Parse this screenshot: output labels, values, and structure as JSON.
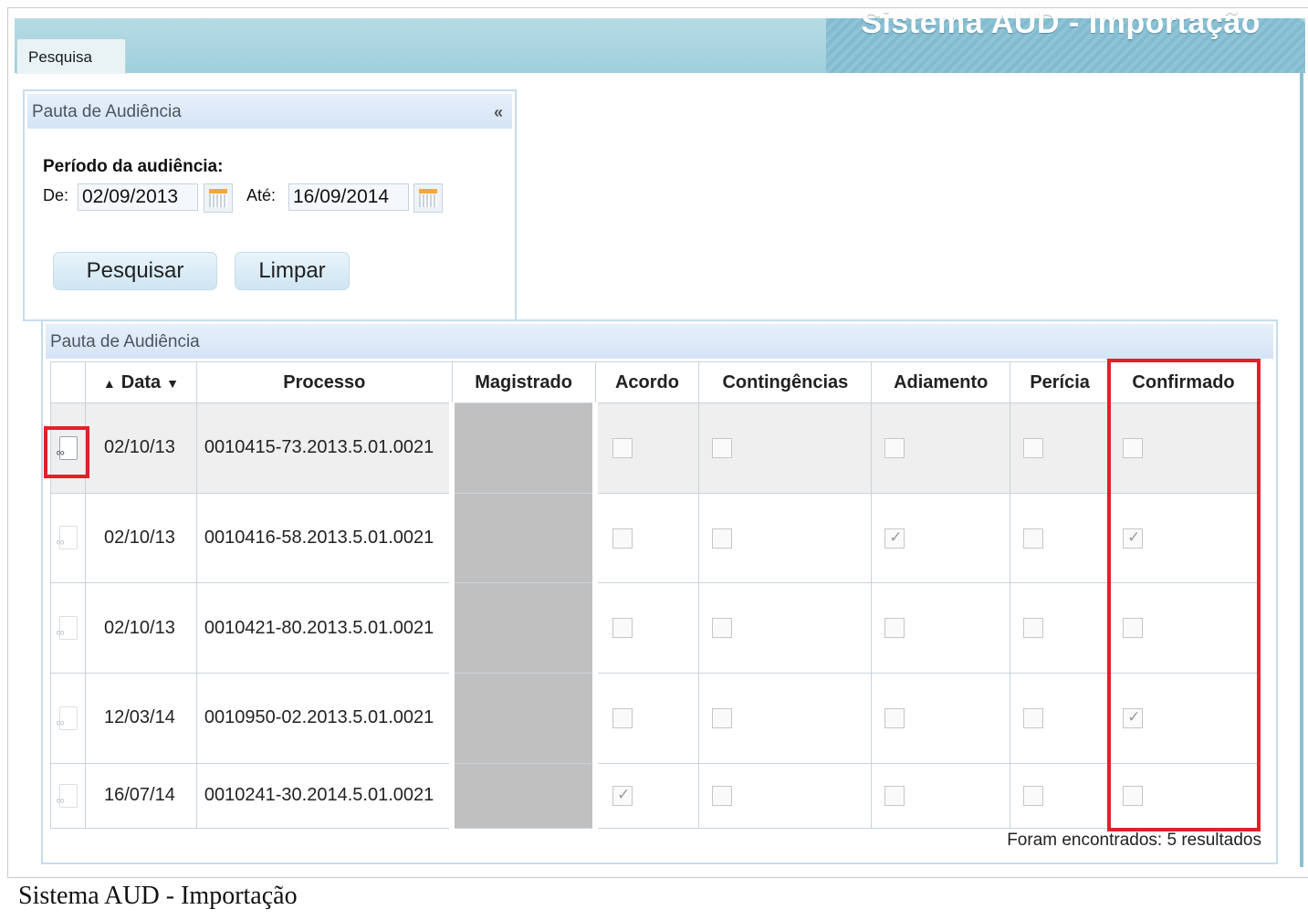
{
  "header": {
    "title": "Sistema AUD - Importação",
    "tab_label": "Pesquisa"
  },
  "search_panel": {
    "title": "Pauta de Audiência",
    "collapse_glyph": "«",
    "period_label": "Período da audiência:",
    "from_label": "De:",
    "from_value": "02/09/2013",
    "to_label": "Até:",
    "to_value": "16/09/2014",
    "search_button": "Pesquisar",
    "clear_button": "Limpar"
  },
  "results_panel": {
    "title": "Pauta de Audiência",
    "columns": [
      "Data",
      "Processo",
      "Magistrado",
      "Acordo",
      "Contingências",
      "Adiamento",
      "Perícia",
      "Confirmado"
    ],
    "rows": [
      {
        "data": "02/10/13",
        "processo": "0010415-73.2013.5.01.0021",
        "acordo": false,
        "contingencias": false,
        "adiamento": false,
        "pericia": false,
        "confirmado": false
      },
      {
        "data": "02/10/13",
        "processo": "0010416-58.2013.5.01.0021",
        "acordo": false,
        "contingencias": false,
        "adiamento": true,
        "pericia": false,
        "confirmado": true
      },
      {
        "data": "02/10/13",
        "processo": "0010421-80.2013.5.01.0021",
        "acordo": false,
        "contingencias": false,
        "adiamento": false,
        "pericia": false,
        "confirmado": false
      },
      {
        "data": "12/03/14",
        "processo": "0010950-02.2013.5.01.0021",
        "acordo": false,
        "contingencias": false,
        "adiamento": false,
        "pericia": false,
        "confirmado": true
      },
      {
        "data": "16/07/14",
        "processo": "0010241-30.2014.5.01.0021",
        "acordo": true,
        "contingencias": false,
        "adiamento": false,
        "pericia": false,
        "confirmado": false
      }
    ],
    "result_count": "Foram encontrados: 5 resultados"
  },
  "caption": "Sistema AUD - Importação",
  "colors": {
    "highlight": "#e3202a",
    "header_band": "#9fcfdc",
    "redacted": "#c0c0c0"
  },
  "icons": {
    "edit": "edit-document-icon",
    "calendar": "calendar-icon"
  }
}
